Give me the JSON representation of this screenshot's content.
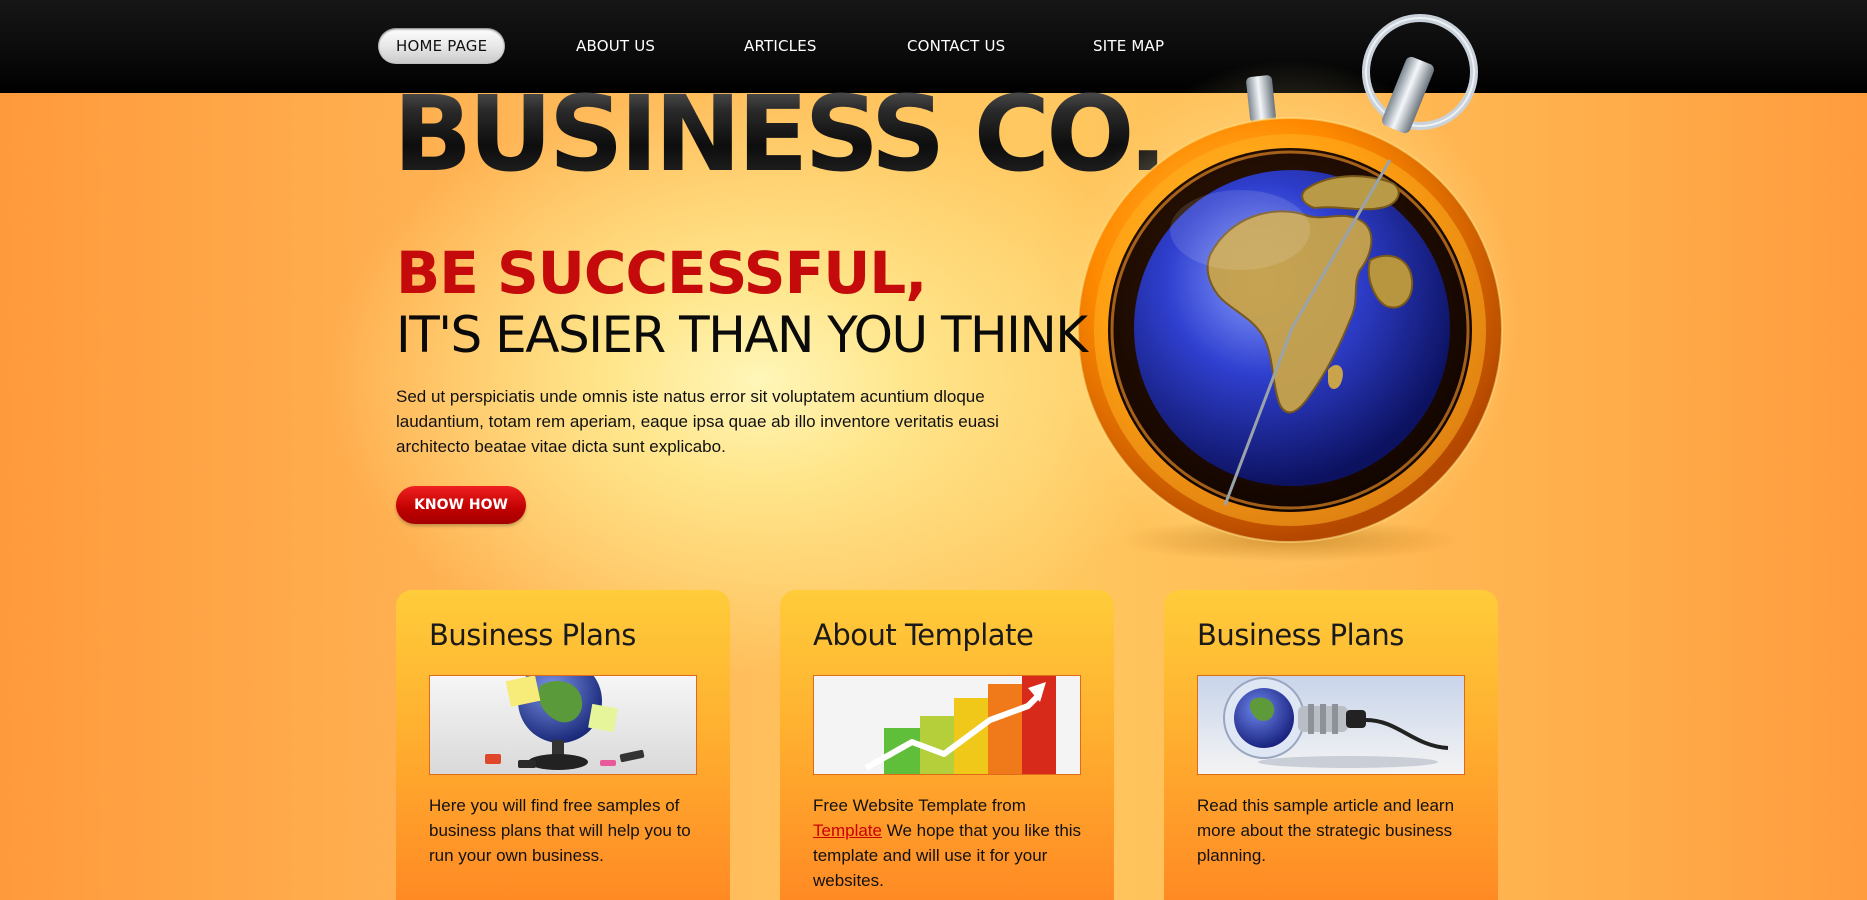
{
  "nav": {
    "items": [
      {
        "label": "HOME PAGE",
        "active": true
      },
      {
        "label": "ABOUT US"
      },
      {
        "label": "ARTICLES"
      },
      {
        "label": "CONTACT US"
      },
      {
        "label": "SITE MAP"
      }
    ]
  },
  "brand": {
    "logo": "BUSINESS CO."
  },
  "hero": {
    "headline_line1": "BE SUCCESSFUL,",
    "headline_line2": "IT'S EASIER THAN YOU THINK",
    "intro": "Sed ut perspiciatis unde omnis iste natus error sit voluptatem acuntium dloque laudantium, totam rem aperiam, eaque ipsa quae ab illo inventore veritatis euasi architecto beatae vitae dicta sunt explicabo.",
    "cta_label": "KNOW HOW",
    "image": "globe-stopwatch-icon"
  },
  "cards": [
    {
      "title": "Business Plans",
      "image": "globe-desk-photo",
      "text": "Here you will find free samples of business plans that will help you to run your own business."
    },
    {
      "title": "About Template",
      "image": "bar-chart-arrow-photo",
      "text_before": "Free Website Template from ",
      "link_label": "Template",
      "text_after": " We hope that you like this template and will use it for your websites."
    },
    {
      "title": "Business Plans",
      "image": "globe-lightbulb-photo",
      "text": "Read this sample article and learn more about the strategic business planning."
    }
  ],
  "colors": {
    "accent_red": "#c40a0a",
    "background_orange": "#ffb450",
    "topbar": "#0a0a0a"
  }
}
